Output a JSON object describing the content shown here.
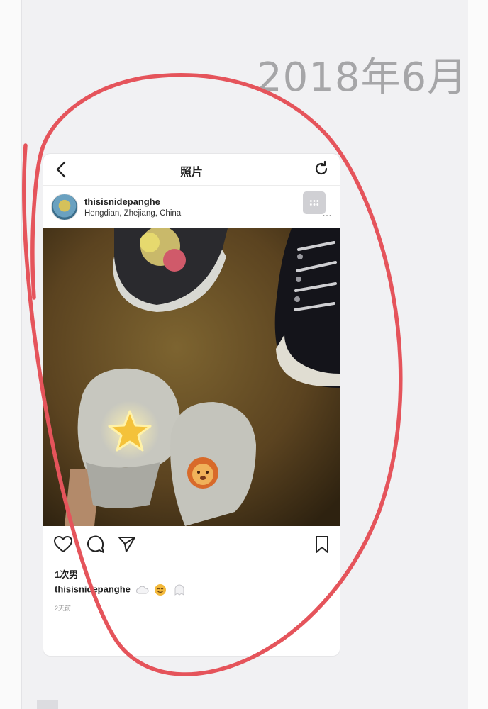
{
  "page": {
    "date_heading": "2018年6月"
  },
  "nav": {
    "back_icon": "chevron-left-icon",
    "title": "照片",
    "refresh_icon": "refresh-icon"
  },
  "post": {
    "username": "thisisnidepanghe",
    "location": "Hengdian, Zhejiang, China",
    "views": "1次男",
    "caption_user": "thisisnidepanghe",
    "time_ago": "2天前"
  },
  "actions": {
    "like_icon": "heart-icon",
    "comment_icon": "comment-icon",
    "share_icon": "send-icon",
    "bookmark_icon": "bookmark-icon"
  },
  "colors": {
    "annotation_circle": "#e5545b",
    "background": "#f1f1f3",
    "heading": "#a6a6a8"
  }
}
